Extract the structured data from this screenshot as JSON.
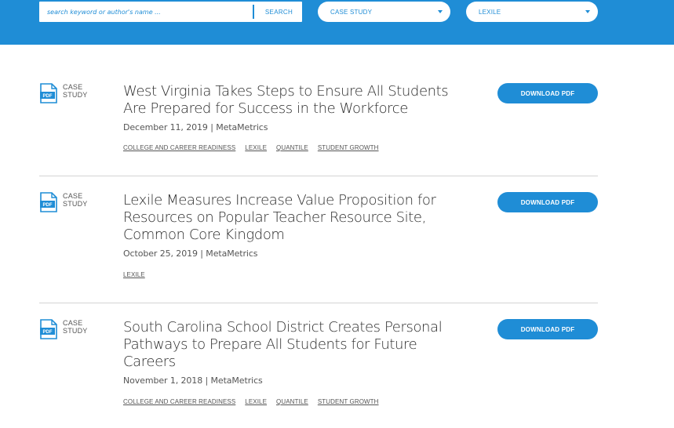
{
  "filters": {
    "search_placeholder": "search keyword or author's name ...",
    "search_button": "SEARCH",
    "type_select": "CASE STUDY",
    "lexile_select": "LEXILE"
  },
  "colors": {
    "brand": "#1f8dd6",
    "divider": "#d4d4d4"
  },
  "items": [
    {
      "type_line1": "CASE",
      "type_line2": "STUDY",
      "title": "West Virginia Takes Steps to Ensure All Students Are Prepared for Success in the Workforce",
      "meta": "December 11, 2019 | MetaMetrics",
      "tags": [
        "COLLEGE AND CAREER READINESS",
        "LEXILE",
        "QUANTILE",
        "STUDENT GROWTH"
      ],
      "download": "DOWNLOAD PDF",
      "icon": "pdf-file-icon"
    },
    {
      "type_line1": "CASE",
      "type_line2": "STUDY",
      "title": "Lexile Measures Increase Value Proposition for Resources on Popular Teacher Resource Site, Common Core Kingdom",
      "meta": "October 25, 2019 | MetaMetrics",
      "tags": [
        "LEXILE"
      ],
      "download": "DOWNLOAD PDF",
      "icon": "pdf-file-icon"
    },
    {
      "type_line1": "CASE",
      "type_line2": "STUDY",
      "title": "South Carolina School District Creates Personal Pathways to Prepare All Students for Future Careers",
      "meta": "November 1, 2018 | MetaMetrics",
      "tags": [
        "COLLEGE AND CAREER READINESS",
        "LEXILE",
        "QUANTILE",
        "STUDENT GROWTH"
      ],
      "download": "DOWNLOAD PDF",
      "icon": "pdf-file-icon"
    }
  ],
  "pdf_icon_text": "PDF"
}
